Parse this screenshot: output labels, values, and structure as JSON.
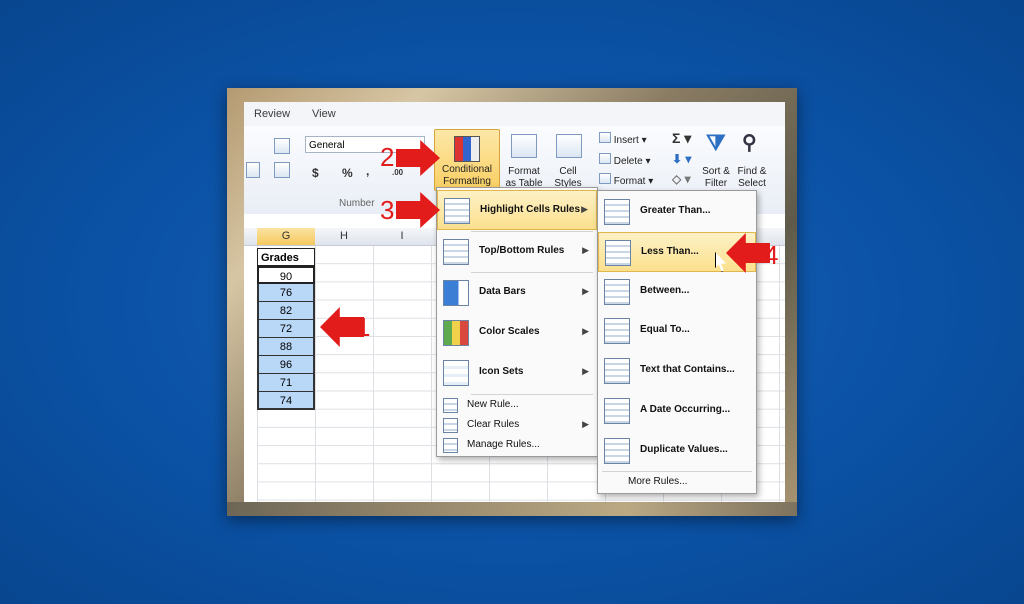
{
  "ribbon": {
    "tabs": [
      "Review",
      "View"
    ],
    "number_format": "General",
    "currency_symbol": "$",
    "percent_symbol": "%",
    "comma_symbol": ",",
    "group_number_label": "Number",
    "conditional_formatting": "Conditional\nFormatting",
    "format_as_table": "Format\nas Table",
    "cell_styles": "Cell\nStyles",
    "insert": "Insert",
    "delete": "Delete",
    "format": "Format",
    "sort_filter": "Sort &\nFilter",
    "find_select": "Find &\nSelect"
  },
  "sheet": {
    "columns": [
      "G",
      "H",
      "I"
    ],
    "header": "Grades",
    "values": [
      "90",
      "76",
      "82",
      "72",
      "88",
      "96",
      "71",
      "74"
    ]
  },
  "menu1": {
    "items": [
      {
        "label": "Highlight Cells Rules",
        "icon": "highlight-cells-icon"
      },
      {
        "label": "Top/Bottom Rules",
        "icon": "top-bottom-icon"
      },
      {
        "label": "Data Bars",
        "icon": "data-bars-icon"
      },
      {
        "label": "Color Scales",
        "icon": "color-scales-icon"
      },
      {
        "label": "Icon Sets",
        "icon": "icon-sets-icon"
      }
    ],
    "small_items": [
      "New Rule...",
      "Clear Rules",
      "Manage Rules..."
    ]
  },
  "menu2": {
    "items": [
      "Greater Than...",
      "Less Than...",
      "Between...",
      "Equal To...",
      "Text that Contains...",
      "A Date Occurring...",
      "Duplicate Values..."
    ],
    "more": "More Rules..."
  },
  "callouts": [
    "1",
    "2",
    "3",
    "4"
  ],
  "colors": {
    "highlight": "#fbe08d",
    "arrow": "#e21b1b",
    "selection": "#b9d7f7"
  }
}
